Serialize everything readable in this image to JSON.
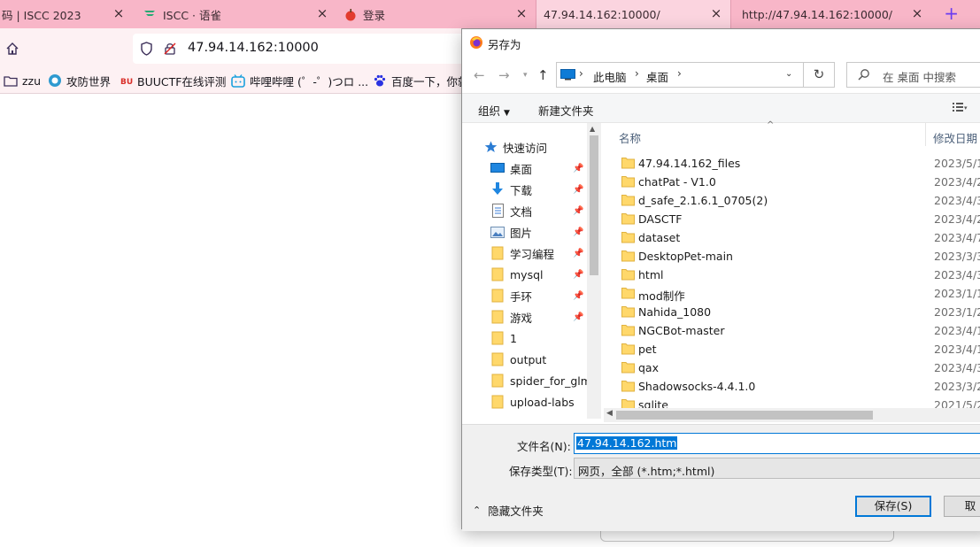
{
  "browser": {
    "tabs": [
      {
        "label": "码 | ISCC 2023",
        "icon": "none"
      },
      {
        "label": "ISCC · 语雀",
        "icon": "yuque-icon"
      },
      {
        "label": "登录",
        "icon": "apple-icon"
      },
      {
        "label": "47.94.14.162:10000/",
        "icon": "none"
      },
      {
        "label": "http://47.94.14.162:10000/",
        "icon": "none"
      }
    ],
    "close_glyph": "×",
    "new_tab_glyph": "+",
    "url": "47.94.14.162:10000",
    "bookmarks": [
      {
        "label": "zzu",
        "icon": "folder-icon"
      },
      {
        "label": "攻防世界",
        "icon": "shield-logo-icon"
      },
      {
        "label": "BUUCTF在线评测",
        "icon": "buu-icon"
      },
      {
        "label": "哔哩哔哩 (゜-゜)つロ ...",
        "icon": "bilibili-icon"
      },
      {
        "label": "百度一下，你就",
        "icon": "baidu-paw-icon"
      }
    ]
  },
  "dialog": {
    "title": "另存为",
    "breadcrumb": [
      "此电脑",
      "桌面"
    ],
    "search_placeholder": "在 桌面 中搜索",
    "toolbar": {
      "organize": "组织",
      "new_folder": "新建文件夹"
    },
    "quick_access_label": "快速访问",
    "nav_items": [
      {
        "label": "桌面",
        "icon": "desktop-icon",
        "pinned": true
      },
      {
        "label": "下载",
        "icon": "download-arrow-icon",
        "pinned": true
      },
      {
        "label": "文档",
        "icon": "document-icon",
        "pinned": true
      },
      {
        "label": "图片",
        "icon": "picture-icon",
        "pinned": true
      },
      {
        "label": "学习编程",
        "icon": "folder-icon",
        "pinned": true
      },
      {
        "label": "mysql",
        "icon": "folder-icon",
        "pinned": true
      },
      {
        "label": "手环",
        "icon": "folder-icon",
        "pinned": true
      },
      {
        "label": "游戏",
        "icon": "folder-icon",
        "pinned": true
      },
      {
        "label": "1",
        "icon": "folder-icon",
        "pinned": false
      },
      {
        "label": "output",
        "icon": "folder-icon",
        "pinned": false
      },
      {
        "label": "spider_for_glm",
        "icon": "folder-icon",
        "pinned": false
      },
      {
        "label": "upload-labs",
        "icon": "folder-icon",
        "pinned": false
      }
    ],
    "columns": {
      "name": "名称",
      "date": "修改日期"
    },
    "files": [
      {
        "name": "47.94.14.162_files",
        "date": "2023/5/1"
      },
      {
        "name": "chatPat - V1.0",
        "date": "2023/4/2"
      },
      {
        "name": "d_safe_2.1.6.1_0705(2)",
        "date": "2023/4/3"
      },
      {
        "name": "DASCTF",
        "date": "2023/4/2"
      },
      {
        "name": "dataset",
        "date": "2023/4/7"
      },
      {
        "name": "DesktopPet-main",
        "date": "2023/3/3"
      },
      {
        "name": "html",
        "date": "2023/4/3"
      },
      {
        "name": "mod制作",
        "date": "2023/1/1"
      },
      {
        "name": "Nahida_1080",
        "date": "2023/1/2"
      },
      {
        "name": "NGCBot-master",
        "date": "2023/4/1"
      },
      {
        "name": "pet",
        "date": "2023/4/1"
      },
      {
        "name": "qax",
        "date": "2023/4/3"
      },
      {
        "name": "Shadowsocks-4.4.1.0",
        "date": "2023/3/2"
      },
      {
        "name": "sqlite",
        "date": "2021/5/2"
      }
    ],
    "filename_label": "文件名(N):",
    "filename_value": "47.94.14.162.htm",
    "filetype_label": "保存类型(T):",
    "filetype_value": "网页，全部 (*.htm;*.html)",
    "hide_folders": "隐藏文件夹",
    "save_button": "保存(S)",
    "cancel_button": "取"
  }
}
